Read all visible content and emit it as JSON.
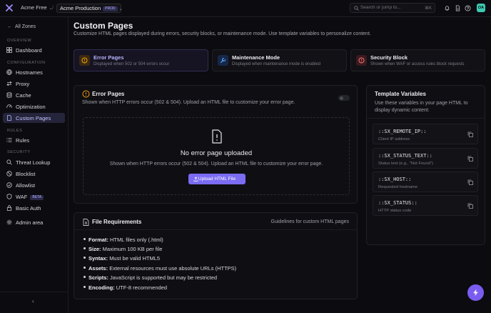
{
  "topbar": {
    "account": "Acme Free",
    "zone": "Acme Production",
    "zone_badge": "PROD",
    "search_placeholder": "Search or jump to...",
    "search_shortcut": "⌘K",
    "avatar_initials": "OA"
  },
  "sidebar": {
    "back_label": "All Zones",
    "sections": {
      "overview": "OVERVIEW",
      "configuration": "CONFIGURATION",
      "rules": "RULES",
      "security": "SECURITY"
    },
    "items": {
      "dashboard": "Dashboard",
      "hostnames": "Hostnames",
      "proxy": "Proxy",
      "cache": "Cache",
      "optimization": "Optimization",
      "custom_pages": "Custom Pages",
      "rules": "Rules",
      "threat_lookup": "Threat Lookup",
      "blocklist": "Blocklist",
      "allowlist": "Allowlist",
      "waf": "WAF",
      "waf_badge": "BETA",
      "basic_auth": "Basic Auth",
      "admin_area": "Admin area"
    },
    "collapse_icon": "chevron-left-icon"
  },
  "page": {
    "title": "Custom Pages",
    "subtitle": "Customize HTML pages displayed during errors, security blocks, or maintenance mode. Use template variables to personalize content."
  },
  "type_cards": [
    {
      "title": "Error Pages",
      "desc": "Displayed when 502 or 504 errors occur"
    },
    {
      "title": "Maintenance Mode",
      "desc": "Displayed when maintenance mode is enabled"
    },
    {
      "title": "Security Block",
      "desc": "Shown when WAF or access rules block requests"
    }
  ],
  "error_panel": {
    "title": "Error Pages",
    "desc": "Shown when HTTP errors occur (502 & 504). Upload an HTML file to customize your error page.",
    "empty_title": "No error page uploaded",
    "empty_desc": "Shown when HTTP errors occur (502 & 504). Upload an HTML file to customize your error page.",
    "upload_label": "Upload HTML File",
    "enabled": false
  },
  "requirements": {
    "title": "File Requirements",
    "right_label": "Guidelines for custom HTML pages",
    "items": [
      {
        "label": "Format:",
        "text": "HTML files only (.html)"
      },
      {
        "label": "Size:",
        "text": "Maximum 100 KB per file"
      },
      {
        "label": "Syntax:",
        "text": "Must be valid HTML5"
      },
      {
        "label": "Assets:",
        "text": "External resources must use absolute URLs (HTTPS)"
      },
      {
        "label": "Scripts:",
        "text": "JavaScript is supported but may be restricted"
      },
      {
        "label": "Encoding:",
        "text": "UTF-8 recommended"
      }
    ]
  },
  "template_vars": {
    "title": "Template Variables",
    "desc": "Use these variables in your page HTML to display dynamic content:",
    "vars": [
      {
        "name": "::SX_REMOTE_IP::",
        "desc": "Client IP address"
      },
      {
        "name": "::SX_STATUS_TEXT::",
        "desc": "Status text (e.g., \"Not Found\")"
      },
      {
        "name": "::SX_HOST::",
        "desc": "Requested hostname"
      },
      {
        "name": "::SX_STATUS::",
        "desc": "HTTP status code"
      }
    ]
  },
  "colors": {
    "accent": "#7b6cf2",
    "background": "#0c0c10",
    "error": "#f59e0b",
    "maintenance": "#60a5fa",
    "security": "#f87171"
  }
}
